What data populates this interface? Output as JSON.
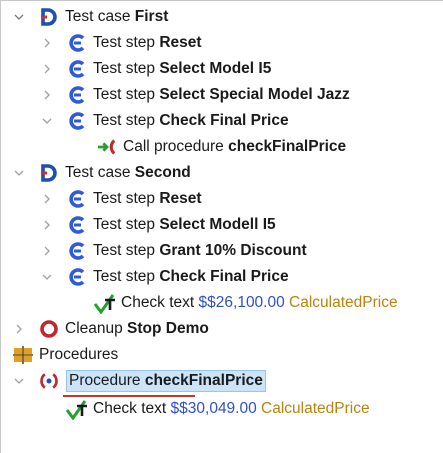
{
  "tree": {
    "rows": [
      {
        "prefix": "Test case ",
        "bold": "First"
      },
      {
        "prefix": "Test step ",
        "bold": "Reset"
      },
      {
        "prefix": "Test step ",
        "bold": "Select Model I5"
      },
      {
        "prefix": "Test step ",
        "bold": "Select Special Model Jazz"
      },
      {
        "prefix": "Test step ",
        "bold": "Check Final Price"
      },
      {
        "prefix": "Call procedure ",
        "bold": "checkFinalPrice"
      },
      {
        "prefix": "Test case ",
        "bold": "Second"
      },
      {
        "prefix": "Test step ",
        "bold": "Reset"
      },
      {
        "prefix": "Test step ",
        "bold": "Select Modell I5"
      },
      {
        "prefix": "Test step ",
        "bold": "Grant 10% Discount"
      },
      {
        "prefix": "Test step ",
        "bold": "Check Final Price"
      },
      {
        "prefix": "Check text ",
        "var": "$$26,100.00",
        "res": "CalculatedPrice"
      },
      {
        "prefix": "Cleanup ",
        "bold": "Stop Demo"
      },
      {
        "prefix": "Procedures",
        "bold": ""
      },
      {
        "prefix": "Procedure ",
        "bold": "checkFinalPrice"
      },
      {
        "prefix": "Check text ",
        "var": "$$30,049.00",
        "res": "CalculatedPrice"
      }
    ]
  },
  "colors": {
    "test_case_icon_blue": "#1f4fb0",
    "test_case_icon_red": "#d03030",
    "test_step_icon_blue": "#2f5bd8",
    "call_icon_green": "#2aa02a",
    "call_icon_red": "#c0282f",
    "check_icon_green": "#22a030",
    "cleanup_icon_red": "#c0282f",
    "procedures_icon_orange": "#e0a020",
    "selection_bg": "#cce4fa",
    "variable_color": "#2f50c8",
    "resource_color": "#b88410"
  }
}
